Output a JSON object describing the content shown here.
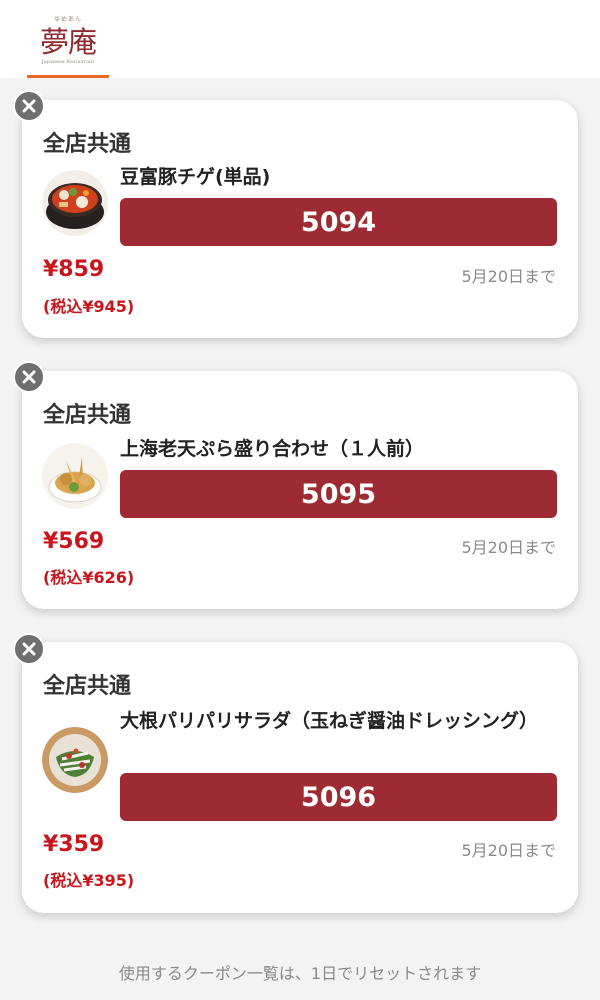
{
  "header": {
    "logo_text": "夢庵",
    "logo_furigana": "ゆめあん",
    "logo_subtitle": "Japanese Restaurant"
  },
  "coupons": [
    {
      "scope": "全店共通",
      "name": "豆富豚チゲ(単品)",
      "code": "5094",
      "price": "¥859",
      "tax_price": "(税込¥945)",
      "until": "5月20日まで",
      "image_icon": "kimchi-stew-photo"
    },
    {
      "scope": "全店共通",
      "name": "上海老天ぷら盛り合わせ（１人前）",
      "code": "5095",
      "price": "¥569",
      "tax_price": "(税込¥626)",
      "until": "5月20日まで",
      "image_icon": "tempura-photo"
    },
    {
      "scope": "全店共通",
      "name": "大根パリパリサラダ（玉ねぎ醤油ドレッシング）",
      "code": "5096",
      "price": "¥359",
      "tax_price": "(税込¥395)",
      "until": "5月20日まで",
      "image_icon": "radish-salad-photo"
    }
  ],
  "footer": {
    "note": "使用するクーポン一覧は、1日でリセットされます"
  },
  "colors": {
    "code_bg": "#9e2a33",
    "price": "#c9151c",
    "tab_underline": "#e86a21",
    "logo": "#8f2a2f"
  }
}
